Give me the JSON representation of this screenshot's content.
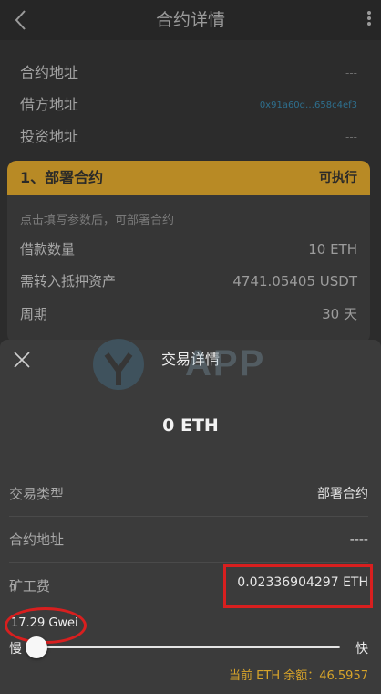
{
  "header": {
    "title": "合约详情"
  },
  "info": [
    {
      "label": "合约地址",
      "value": "---"
    },
    {
      "label": "借方地址",
      "value": "0x91a60d…658c4ef3"
    },
    {
      "label": "投资地址",
      "value": "---"
    }
  ],
  "card": {
    "title": "1、部署合约",
    "status": "可执行",
    "hint": "点击填写参数后，可部署合约",
    "rows": [
      {
        "label": "借款数量",
        "value": "10 ETH"
      },
      {
        "label": "需转入抵押资产",
        "value": "4741.05405 USDT"
      },
      {
        "label": "周期",
        "value": "30 天"
      }
    ]
  },
  "sheet": {
    "title": "交易详情",
    "watermark": "APP",
    "amount": "0 ETH",
    "rows": [
      {
        "label": "交易类型",
        "value": "部署合约"
      },
      {
        "label": "合约地址",
        "value": "----"
      },
      {
        "label": "矿工费",
        "value": "0.02336904297 ETH"
      }
    ],
    "gas_price": "17.29 Gwei",
    "slider_level": 0.0,
    "slow_label": "慢",
    "fast_label": "快",
    "balance": "当前 ETH 余额：46.5957"
  },
  "colors": {
    "accent": "#b88a25",
    "balance": "#d7a42a",
    "highlight": "#d81f1f",
    "link": "#2e6f8e"
  }
}
